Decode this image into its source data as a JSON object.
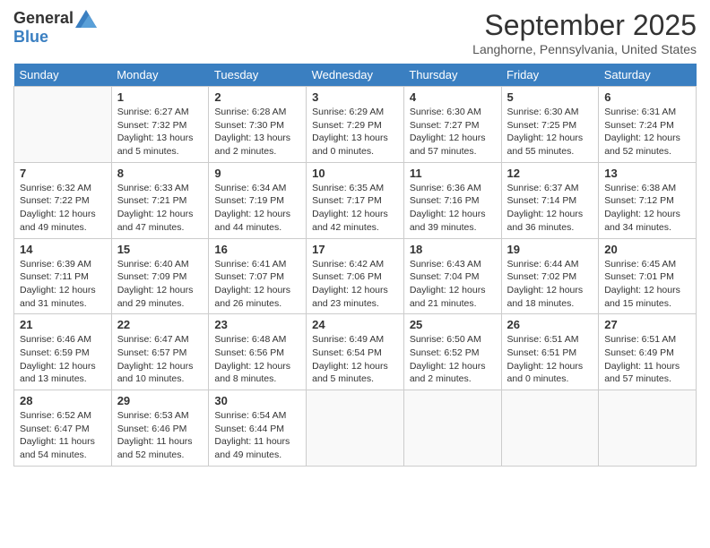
{
  "header": {
    "logo_general": "General",
    "logo_blue": "Blue",
    "month_title": "September 2025",
    "location": "Langhorne, Pennsylvania, United States"
  },
  "days_of_week": [
    "Sunday",
    "Monday",
    "Tuesday",
    "Wednesday",
    "Thursday",
    "Friday",
    "Saturday"
  ],
  "weeks": [
    [
      {
        "num": "",
        "sunrise": "",
        "sunset": "",
        "daylight": ""
      },
      {
        "num": "1",
        "sunrise": "Sunrise: 6:27 AM",
        "sunset": "Sunset: 7:32 PM",
        "daylight": "Daylight: 13 hours and 5 minutes."
      },
      {
        "num": "2",
        "sunrise": "Sunrise: 6:28 AM",
        "sunset": "Sunset: 7:30 PM",
        "daylight": "Daylight: 13 hours and 2 minutes."
      },
      {
        "num": "3",
        "sunrise": "Sunrise: 6:29 AM",
        "sunset": "Sunset: 7:29 PM",
        "daylight": "Daylight: 13 hours and 0 minutes."
      },
      {
        "num": "4",
        "sunrise": "Sunrise: 6:30 AM",
        "sunset": "Sunset: 7:27 PM",
        "daylight": "Daylight: 12 hours and 57 minutes."
      },
      {
        "num": "5",
        "sunrise": "Sunrise: 6:30 AM",
        "sunset": "Sunset: 7:25 PM",
        "daylight": "Daylight: 12 hours and 55 minutes."
      },
      {
        "num": "6",
        "sunrise": "Sunrise: 6:31 AM",
        "sunset": "Sunset: 7:24 PM",
        "daylight": "Daylight: 12 hours and 52 minutes."
      }
    ],
    [
      {
        "num": "7",
        "sunrise": "Sunrise: 6:32 AM",
        "sunset": "Sunset: 7:22 PM",
        "daylight": "Daylight: 12 hours and 49 minutes."
      },
      {
        "num": "8",
        "sunrise": "Sunrise: 6:33 AM",
        "sunset": "Sunset: 7:21 PM",
        "daylight": "Daylight: 12 hours and 47 minutes."
      },
      {
        "num": "9",
        "sunrise": "Sunrise: 6:34 AM",
        "sunset": "Sunset: 7:19 PM",
        "daylight": "Daylight: 12 hours and 44 minutes."
      },
      {
        "num": "10",
        "sunrise": "Sunrise: 6:35 AM",
        "sunset": "Sunset: 7:17 PM",
        "daylight": "Daylight: 12 hours and 42 minutes."
      },
      {
        "num": "11",
        "sunrise": "Sunrise: 6:36 AM",
        "sunset": "Sunset: 7:16 PM",
        "daylight": "Daylight: 12 hours and 39 minutes."
      },
      {
        "num": "12",
        "sunrise": "Sunrise: 6:37 AM",
        "sunset": "Sunset: 7:14 PM",
        "daylight": "Daylight: 12 hours and 36 minutes."
      },
      {
        "num": "13",
        "sunrise": "Sunrise: 6:38 AM",
        "sunset": "Sunset: 7:12 PM",
        "daylight": "Daylight: 12 hours and 34 minutes."
      }
    ],
    [
      {
        "num": "14",
        "sunrise": "Sunrise: 6:39 AM",
        "sunset": "Sunset: 7:11 PM",
        "daylight": "Daylight: 12 hours and 31 minutes."
      },
      {
        "num": "15",
        "sunrise": "Sunrise: 6:40 AM",
        "sunset": "Sunset: 7:09 PM",
        "daylight": "Daylight: 12 hours and 29 minutes."
      },
      {
        "num": "16",
        "sunrise": "Sunrise: 6:41 AM",
        "sunset": "Sunset: 7:07 PM",
        "daylight": "Daylight: 12 hours and 26 minutes."
      },
      {
        "num": "17",
        "sunrise": "Sunrise: 6:42 AM",
        "sunset": "Sunset: 7:06 PM",
        "daylight": "Daylight: 12 hours and 23 minutes."
      },
      {
        "num": "18",
        "sunrise": "Sunrise: 6:43 AM",
        "sunset": "Sunset: 7:04 PM",
        "daylight": "Daylight: 12 hours and 21 minutes."
      },
      {
        "num": "19",
        "sunrise": "Sunrise: 6:44 AM",
        "sunset": "Sunset: 7:02 PM",
        "daylight": "Daylight: 12 hours and 18 minutes."
      },
      {
        "num": "20",
        "sunrise": "Sunrise: 6:45 AM",
        "sunset": "Sunset: 7:01 PM",
        "daylight": "Daylight: 12 hours and 15 minutes."
      }
    ],
    [
      {
        "num": "21",
        "sunrise": "Sunrise: 6:46 AM",
        "sunset": "Sunset: 6:59 PM",
        "daylight": "Daylight: 12 hours and 13 minutes."
      },
      {
        "num": "22",
        "sunrise": "Sunrise: 6:47 AM",
        "sunset": "Sunset: 6:57 PM",
        "daylight": "Daylight: 12 hours and 10 minutes."
      },
      {
        "num": "23",
        "sunrise": "Sunrise: 6:48 AM",
        "sunset": "Sunset: 6:56 PM",
        "daylight": "Daylight: 12 hours and 8 minutes."
      },
      {
        "num": "24",
        "sunrise": "Sunrise: 6:49 AM",
        "sunset": "Sunset: 6:54 PM",
        "daylight": "Daylight: 12 hours and 5 minutes."
      },
      {
        "num": "25",
        "sunrise": "Sunrise: 6:50 AM",
        "sunset": "Sunset: 6:52 PM",
        "daylight": "Daylight: 12 hours and 2 minutes."
      },
      {
        "num": "26",
        "sunrise": "Sunrise: 6:51 AM",
        "sunset": "Sunset: 6:51 PM",
        "daylight": "Daylight: 12 hours and 0 minutes."
      },
      {
        "num": "27",
        "sunrise": "Sunrise: 6:51 AM",
        "sunset": "Sunset: 6:49 PM",
        "daylight": "Daylight: 11 hours and 57 minutes."
      }
    ],
    [
      {
        "num": "28",
        "sunrise": "Sunrise: 6:52 AM",
        "sunset": "Sunset: 6:47 PM",
        "daylight": "Daylight: 11 hours and 54 minutes."
      },
      {
        "num": "29",
        "sunrise": "Sunrise: 6:53 AM",
        "sunset": "Sunset: 6:46 PM",
        "daylight": "Daylight: 11 hours and 52 minutes."
      },
      {
        "num": "30",
        "sunrise": "Sunrise: 6:54 AM",
        "sunset": "Sunset: 6:44 PM",
        "daylight": "Daylight: 11 hours and 49 minutes."
      },
      {
        "num": "",
        "sunrise": "",
        "sunset": "",
        "daylight": ""
      },
      {
        "num": "",
        "sunrise": "",
        "sunset": "",
        "daylight": ""
      },
      {
        "num": "",
        "sunrise": "",
        "sunset": "",
        "daylight": ""
      },
      {
        "num": "",
        "sunrise": "",
        "sunset": "",
        "daylight": ""
      }
    ]
  ]
}
